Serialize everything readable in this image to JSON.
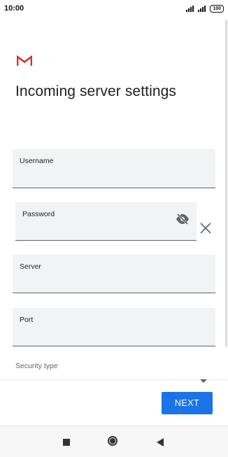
{
  "status_bar": {
    "time": "10:00",
    "battery": "100",
    "icons": [
      "signal-icon",
      "signal-icon",
      "battery-icon"
    ]
  },
  "app": {
    "logo": "gmail-logo",
    "title": "Incoming server settings"
  },
  "form": {
    "username": {
      "label": "Username",
      "value": ""
    },
    "password": {
      "label": "Password",
      "value": ""
    },
    "server": {
      "label": "Server",
      "value": ""
    },
    "port": {
      "label": "Port",
      "value": ""
    },
    "security_type": {
      "label": "Security type",
      "value": ""
    }
  },
  "actions": {
    "next_label": "NEXT"
  },
  "colors": {
    "accent": "#1a73e8",
    "field_bg": "#f1f3f4",
    "gmail_red": "#d93025"
  },
  "nav": {
    "icons": [
      "recents-icon",
      "home-icon",
      "back-icon"
    ]
  }
}
